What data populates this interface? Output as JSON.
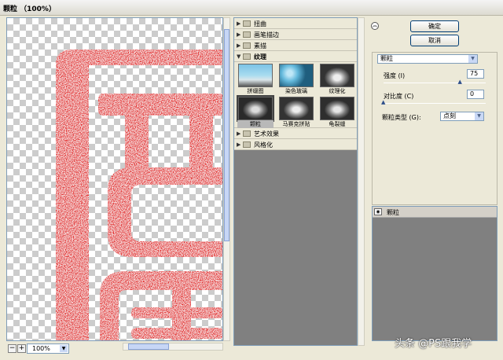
{
  "window": {
    "title": "颗粒 （100%）"
  },
  "preview": {
    "zoom_value": "100%",
    "zoom_out_icon": "minus-icon",
    "zoom_in_icon": "plus-icon"
  },
  "filter_categories": [
    {
      "name": "扭曲",
      "expanded": false
    },
    {
      "name": "画笔描边",
      "expanded": false
    },
    {
      "name": "素描",
      "expanded": false
    },
    {
      "name": "纹理",
      "expanded": true,
      "items": [
        "拼缀图",
        "染色玻璃",
        "纹理化",
        "颗粒",
        "马赛克拼贴",
        "龟裂缝"
      ],
      "selected": "颗粒"
    },
    {
      "name": "艺术效果",
      "expanded": false
    },
    {
      "name": "风格化",
      "expanded": false
    }
  ],
  "buttons": {
    "ok": "确定",
    "cancel": "取消"
  },
  "settings": {
    "filter_select": "颗粒",
    "intensity_label": "强度 (I)",
    "intensity_value": "75",
    "intensity_fraction": 0.75,
    "contrast_label": "对比度 (C)",
    "contrast_value": "0",
    "contrast_fraction": 0.0,
    "grain_type_label": "颗粒类型 (G):",
    "grain_type_value": "点刻"
  },
  "layers": [
    {
      "name": "颗粒",
      "visible": true
    }
  ],
  "watermark": "头条 @PS跟我学",
  "colors": {
    "stamp_red": "#e21b1b",
    "panel_bg": "#ece9d8",
    "list_bg": "#808080"
  }
}
